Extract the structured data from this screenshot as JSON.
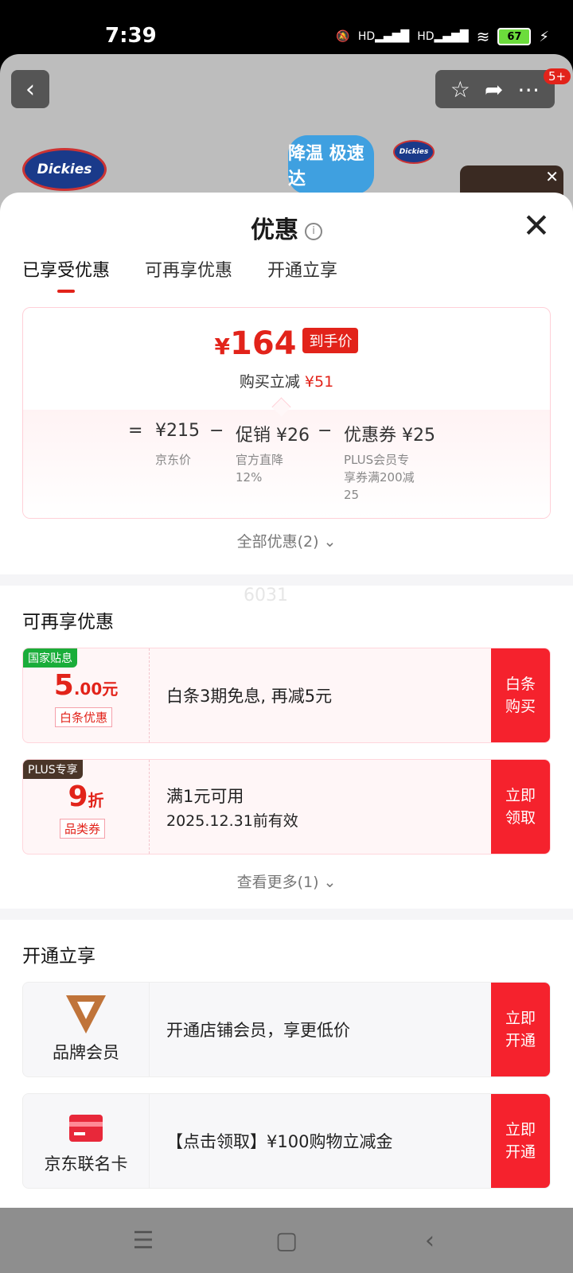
{
  "status_bar": {
    "time": "7:39",
    "hd1": "HD",
    "hd2": "HD",
    "battery": "67"
  },
  "background": {
    "badge": "5+",
    "logo": "Dickies",
    "logo_small": "Dickies",
    "promo": "降温 极速达"
  },
  "sheet": {
    "title": "优惠",
    "tabs": [
      "已享受优惠",
      "可再享优惠",
      "开通立享"
    ],
    "price": {
      "yen": "¥",
      "amount": "164",
      "tag": "到手价",
      "sub_label": "购买立减",
      "sub_value": "¥51",
      "eq": "=",
      "base_value": "¥215",
      "base_label": "京东价",
      "minus1": "−",
      "promo_value": "促销 ¥26",
      "promo_label_1": "官方直降",
      "promo_label_2": "12%",
      "minus2": "−",
      "coupon_value": "优惠券 ¥25",
      "coupon_label_1": "PLUS会员专",
      "coupon_label_2": "享券满200减",
      "coupon_label_3": "25"
    },
    "all_discount": "全部优惠(2) ⌄",
    "watermark": "6031",
    "section_more": "可再享优惠",
    "coupons": [
      {
        "badge": "国家贴息",
        "badge_color": "#1aad3a",
        "value_main": "5",
        "value_small": ".00元",
        "type": "白条优惠",
        "text1": "白条3期免息, 再减5元",
        "text2": "",
        "btn1": "白条",
        "btn2": "购买"
      },
      {
        "badge": "PLUS专享",
        "badge_color": "#4a3528",
        "value_main": "9",
        "value_small": "折",
        "type": "品类券",
        "text1": "满1元可用",
        "text2": "2025.12.31前有效",
        "btn1": "立即",
        "btn2": "领取"
      }
    ],
    "see_more": "查看更多(1) ⌄",
    "section_open": "开通立享",
    "members": [
      {
        "name": "品牌会员",
        "icon": "brand-v-icon",
        "text": "开通店铺会员，享更低价",
        "btn1": "立即",
        "btn2": "开通"
      },
      {
        "name": "京东联名卡",
        "icon": "card-icon",
        "text": "【点击领取】¥100购物立减金",
        "btn1": "立即",
        "btn2": "开通"
      }
    ]
  },
  "colors": {
    "accent": "#e2231a",
    "button": "#f5222d"
  }
}
